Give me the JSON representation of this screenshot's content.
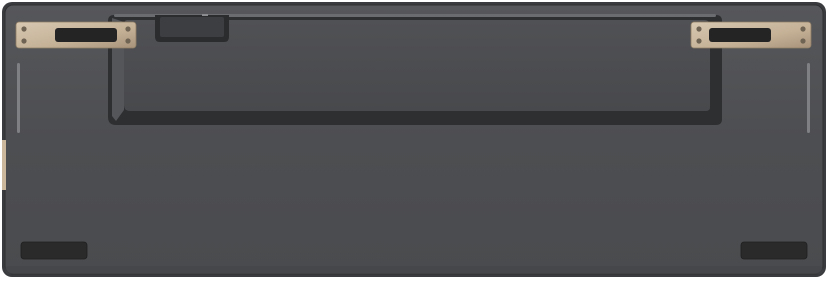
{
  "image": {
    "subject": "keyboard-underside",
    "colors": {
      "body": "#4e4f51",
      "body_edge": "#2f3032",
      "frame": "#5f6063",
      "stand_shadow": "#2b2c2e",
      "stand_face": "#6a6b6e",
      "hinge_metal": "#c9b7a0",
      "hinge_metal_dark": "#9d8a74",
      "rubber_foot": "#2b2b2c",
      "highlight": "#8a8c90",
      "side_accent": "#d8c7ae"
    }
  }
}
